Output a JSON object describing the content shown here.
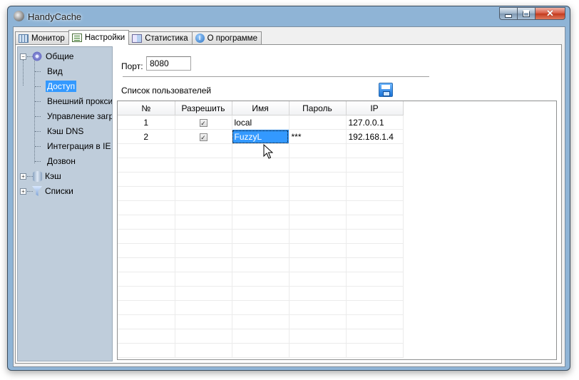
{
  "window": {
    "title": "HandyCache"
  },
  "tabs": [
    {
      "label": "Монитор",
      "icon": "monitor-icon"
    },
    {
      "label": "Настройки",
      "icon": "settings-icon",
      "active": true
    },
    {
      "label": "Статистика",
      "icon": "statistics-icon"
    },
    {
      "label": "О программе",
      "icon": "info-icon"
    }
  ],
  "tree": {
    "general": "Общие",
    "general_children": [
      "Вид",
      "Доступ",
      "Внешний прокси",
      "Управление загру",
      "Кэш DNS",
      "Интеграция в IE",
      "Дозвон"
    ],
    "selected": "Доступ",
    "cache": "Кэш",
    "lists": "Списки"
  },
  "port": {
    "label": "Порт:",
    "value": "8080"
  },
  "users": {
    "label": "Список пользователей",
    "columns": [
      "№",
      "Разрешить",
      "Имя",
      "Пароль",
      "IP"
    ],
    "rows": [
      {
        "num": "1",
        "allowed": true,
        "name": "local",
        "password": "",
        "ip": "127.0.0.1"
      },
      {
        "num": "2",
        "allowed": true,
        "name": "FuzzyL",
        "password": "***",
        "ip": "192.168.1.4"
      }
    ]
  },
  "colors": {
    "accent": "#3399ff",
    "frame": "#8fb4d6",
    "tree_bg": "#bfcddb"
  }
}
